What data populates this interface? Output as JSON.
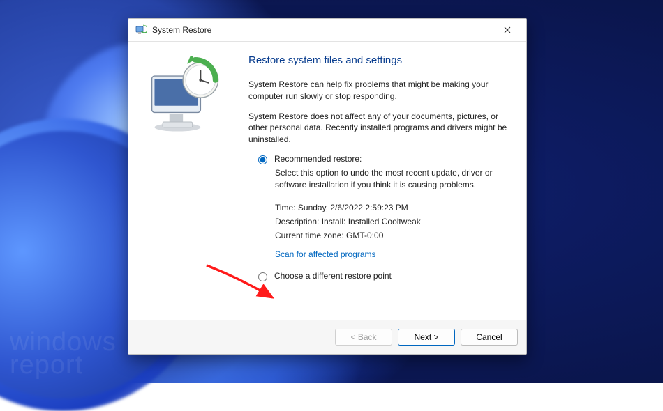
{
  "window": {
    "title": "System Restore"
  },
  "content": {
    "heading": "Restore system files and settings",
    "intro1": "System Restore can help fix problems that might be making your computer run slowly or stop responding.",
    "intro2": "System Restore does not affect any of your documents, pictures, or other personal data. Recently installed programs and drivers might be uninstalled.",
    "option_recommended": {
      "label": "Recommended restore:",
      "desc": "Select this option to undo the most recent update, driver or software installation if you think it is causing problems."
    },
    "details": {
      "time": "Time: Sunday, 2/6/2022 2:59:23 PM",
      "description": "Description: Install: Installed Cooltweak",
      "tz": "Current time zone: GMT-0:00",
      "scan_link": "Scan for affected programs"
    },
    "option_different": "Choose a different restore point"
  },
  "footer": {
    "back": "< Back",
    "next": "Next >",
    "cancel": "Cancel"
  },
  "watermark": {
    "l1": "windows",
    "l2": "report"
  }
}
